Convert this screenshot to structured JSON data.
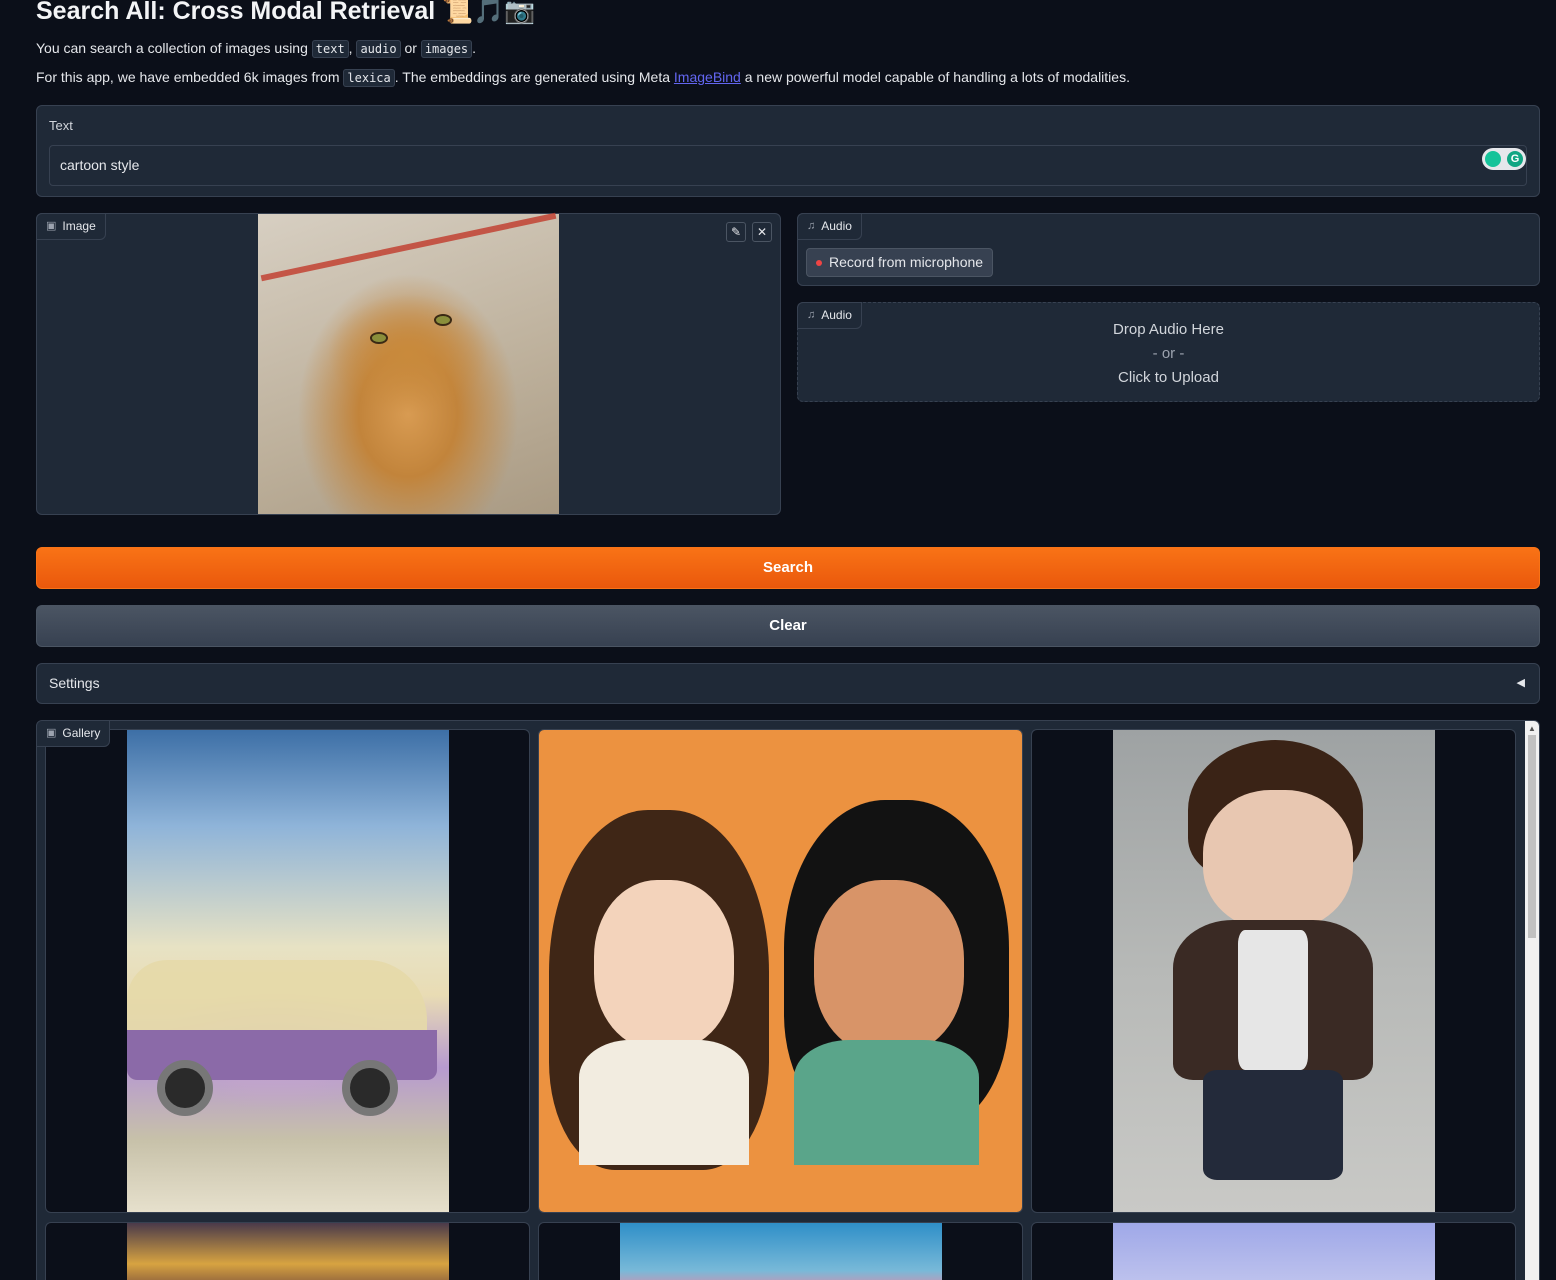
{
  "header": {
    "title": "Search All: Cross Modal Retrieval",
    "title_emoji": "📜🎵📷",
    "desc1_prefix": "You can search a collection of images using ",
    "desc1_code1": "text",
    "desc1_sep1": ", ",
    "desc1_code2": "audio",
    "desc1_sep2": " or ",
    "desc1_code3": "images",
    "desc1_suffix": ".",
    "desc2_prefix": "For this app, we have embedded 6k images from ",
    "desc2_code": "lexica",
    "desc2_mid": ". The embeddings are generated using Meta ",
    "desc2_link": "ImageBind",
    "desc2_suffix": " a new powerful model capable of handling a lots of modalities."
  },
  "text_input": {
    "label": "Text",
    "value": "cartoon style"
  },
  "image_input": {
    "label": "Image",
    "edit_icon": "pencil-icon",
    "clear_icon": "close-icon"
  },
  "audio_mic": {
    "label": "Audio",
    "record_label": "Record from microphone"
  },
  "audio_upload": {
    "label": "Audio",
    "drop_text": "Drop Audio Here",
    "or_text": "- or -",
    "click_text": "Click to Upload"
  },
  "buttons": {
    "search": "Search",
    "clear": "Clear"
  },
  "settings": {
    "label": "Settings",
    "arrow": "◀"
  },
  "gallery": {
    "label": "Gallery"
  },
  "colors": {
    "background": "#0b0f19",
    "panel": "#1f2937",
    "accent": "#f97316",
    "link": "#6366f1"
  }
}
